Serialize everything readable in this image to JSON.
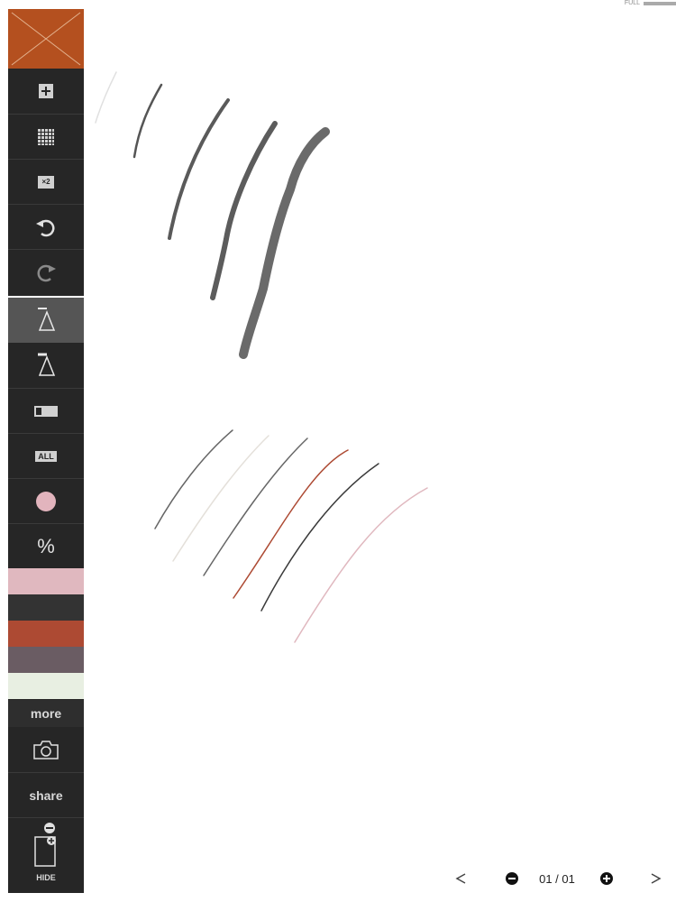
{
  "toolbar": {
    "more_label": "more",
    "share_label": "share",
    "hide_label": "HIDE",
    "all_label": "ALL",
    "x2_label": "×2",
    "percent_label": "%",
    "current_color": "#e2b4bd",
    "icons": [
      "close-icon",
      "add-icon",
      "grid-icon",
      "multiply-icon",
      "undo-icon",
      "redo-icon",
      "pen-thick-icon",
      "pen-thin-icon",
      "eraser-icon",
      "select-all-icon",
      "color-icon",
      "opacity-icon",
      "camera-icon",
      "page-icon"
    ]
  },
  "palette": [
    "#e0b8bf",
    "#333333",
    "#ad4a33",
    "#6a5c63",
    "#e8efe2"
  ],
  "accent": "#b4501f",
  "top_right": {
    "full_label": "FULL"
  },
  "footer": {
    "prev_icon": "prev-page-icon",
    "next_icon": "next-page-icon",
    "page_label": "01 / 01"
  }
}
